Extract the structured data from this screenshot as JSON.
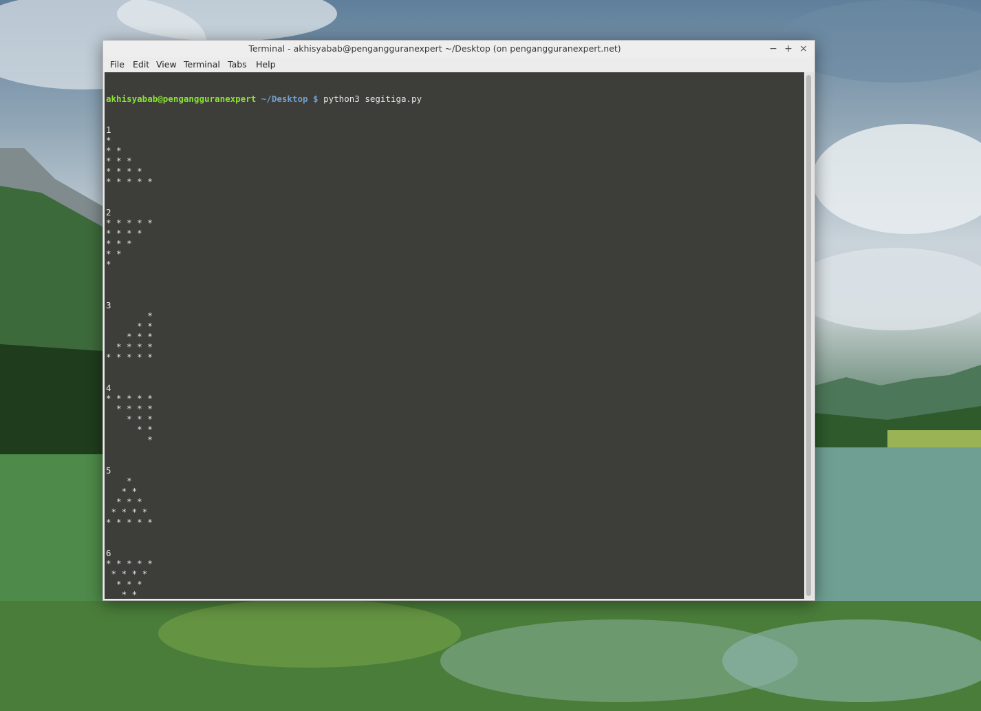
{
  "window": {
    "title": "Terminal - akhisyabab@pengangguranexpert ~/Desktop (on pengangguranexpert.net)",
    "controls": {
      "minimize": "−",
      "maximize": "+",
      "close": "×"
    }
  },
  "menubar": {
    "items": [
      "File",
      "Edit",
      "View",
      "Terminal",
      "Tabs",
      "Help"
    ]
  },
  "terminal": {
    "prompt": {
      "user_host": "akhisyabab@pengangguranexpert",
      "path": "~/Desktop",
      "symbol": "$"
    },
    "command": "python3 segitiga.py",
    "output": [
      "1",
      "*",
      "* *",
      "* * *",
      "* * * *",
      "* * * * *",
      "",
      "",
      "2",
      "* * * * *",
      "* * * *",
      "* * *",
      "* *",
      "*",
      "",
      "",
      "",
      "3",
      "        *",
      "      * *",
      "    * * *",
      "  * * * *",
      "* * * * *",
      "",
      "",
      "4",
      "* * * * *",
      "  * * * *",
      "    * * *",
      "      * *",
      "        *",
      "",
      "",
      "5",
      "    *",
      "   * *",
      "  * * *",
      " * * * *",
      "* * * * *",
      "",
      "",
      "6",
      "* * * * *",
      " * * * *",
      "  * * *",
      "   * *",
      "    *"
    ]
  },
  "colors": {
    "prompt_user": "#8ae234",
    "prompt_path": "#729fcf",
    "terminal_text": "#e6e6e6"
  }
}
